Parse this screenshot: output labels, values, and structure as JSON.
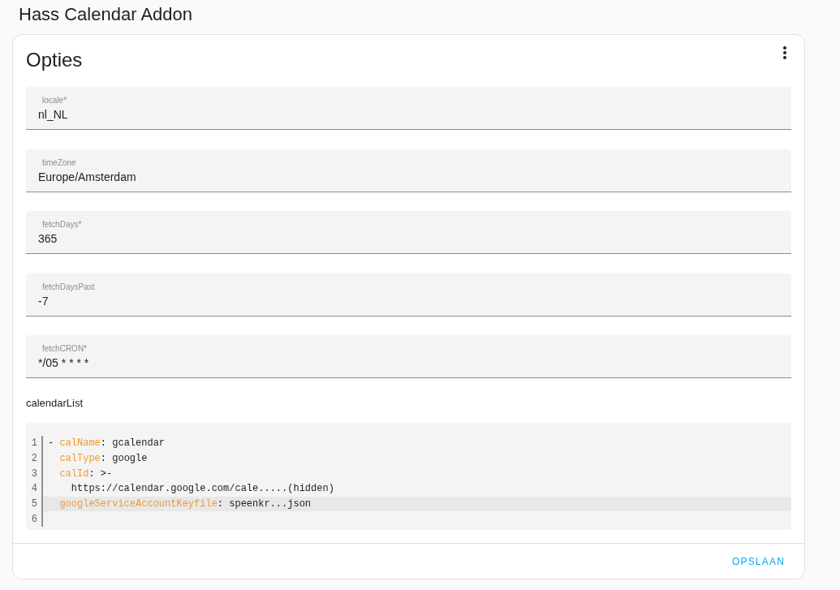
{
  "page_title": "Hass Calendar Addon",
  "card": {
    "title": "Opties",
    "fields": [
      {
        "label": "locale*",
        "value": "nl_NL"
      },
      {
        "label": "timeZone",
        "value": "Europe/Amsterdam"
      },
      {
        "label": "fetchDays*",
        "value": "365"
      },
      {
        "label": "fetchDaysPast",
        "value": "-7"
      },
      {
        "label": "fetchCRON*",
        "value": "*/05 * * * *"
      }
    ],
    "calendar_list": {
      "label": "calendarList",
      "lines": [
        {
          "number": "1",
          "highlighted": false,
          "tokens": [
            {
              "kind": "plain",
              "text": "- "
            },
            {
              "kind": "key",
              "text": "calName"
            },
            {
              "kind": "plain",
              "text": ": gcalendar"
            }
          ]
        },
        {
          "number": "2",
          "highlighted": false,
          "tokens": [
            {
              "kind": "key",
              "text": "  calType"
            },
            {
              "kind": "plain",
              "text": ": google"
            }
          ]
        },
        {
          "number": "3",
          "highlighted": false,
          "tokens": [
            {
              "kind": "key",
              "text": "  calId"
            },
            {
              "kind": "plain",
              "text": ": >-"
            }
          ]
        },
        {
          "number": "4",
          "highlighted": false,
          "tokens": [
            {
              "kind": "plain",
              "text": "    https://calendar.google.com/cale.....(hidden)"
            }
          ]
        },
        {
          "number": "5",
          "highlighted": true,
          "tokens": [
            {
              "kind": "key",
              "text": "  googleServiceAccountKeyfile"
            },
            {
              "kind": "plain",
              "text": ": speenkr...json"
            }
          ]
        },
        {
          "number": "6",
          "highlighted": false
        }
      ]
    },
    "actions": [
      "OPSLAAN"
    ]
  }
}
